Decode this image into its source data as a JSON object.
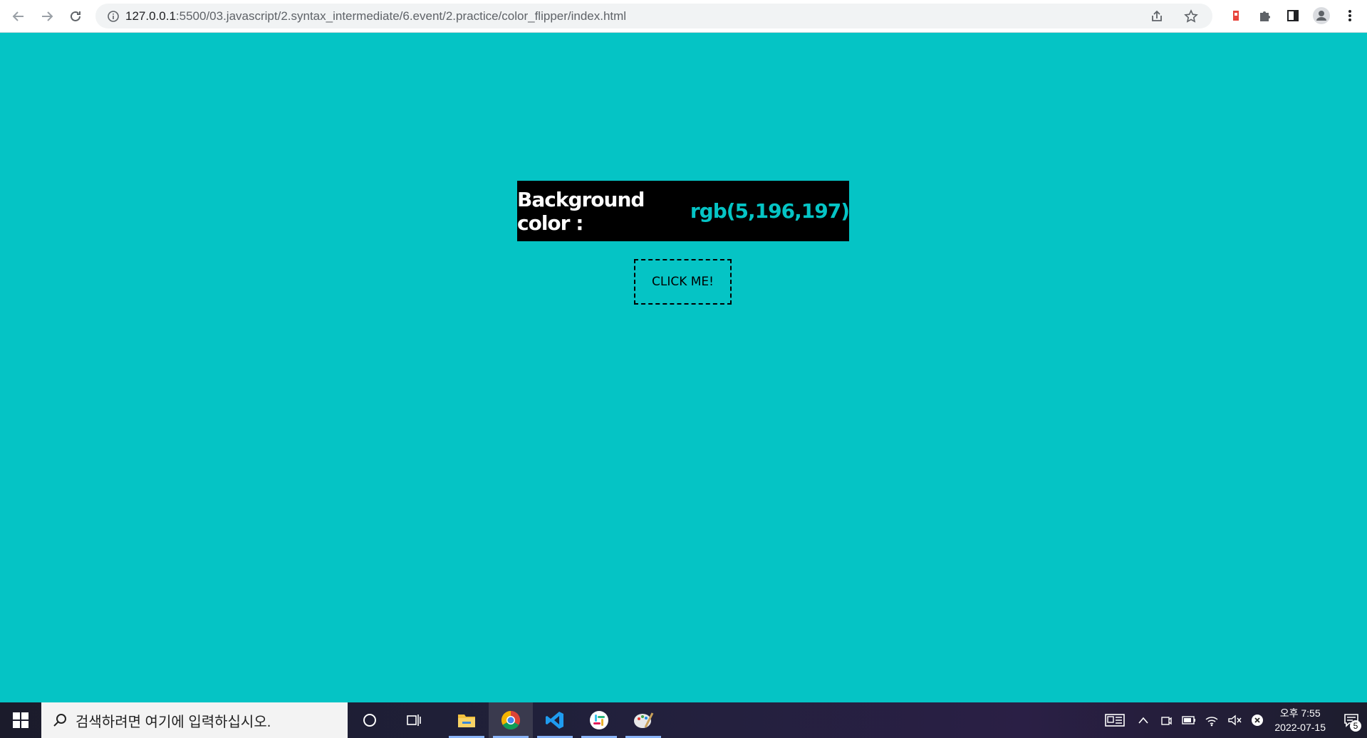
{
  "browser": {
    "url_host": "127.0.0.1",
    "url_path": ":5500/03.javascript/2.syntax_intermediate/6.event/2.practice/color_flipper/index.html"
  },
  "page": {
    "label": "Background color :",
    "value": "rgb(5,196,197)",
    "button_label": "CLICK ME!"
  },
  "taskbar": {
    "search_placeholder": "검색하려면 여기에 입력하십시오.",
    "time": "오후 7:55",
    "date": "2022-07-15",
    "notification_count": "5"
  },
  "colors": {
    "background": "#05c4c5",
    "box": "#000000",
    "accent": "#05c4c5"
  }
}
